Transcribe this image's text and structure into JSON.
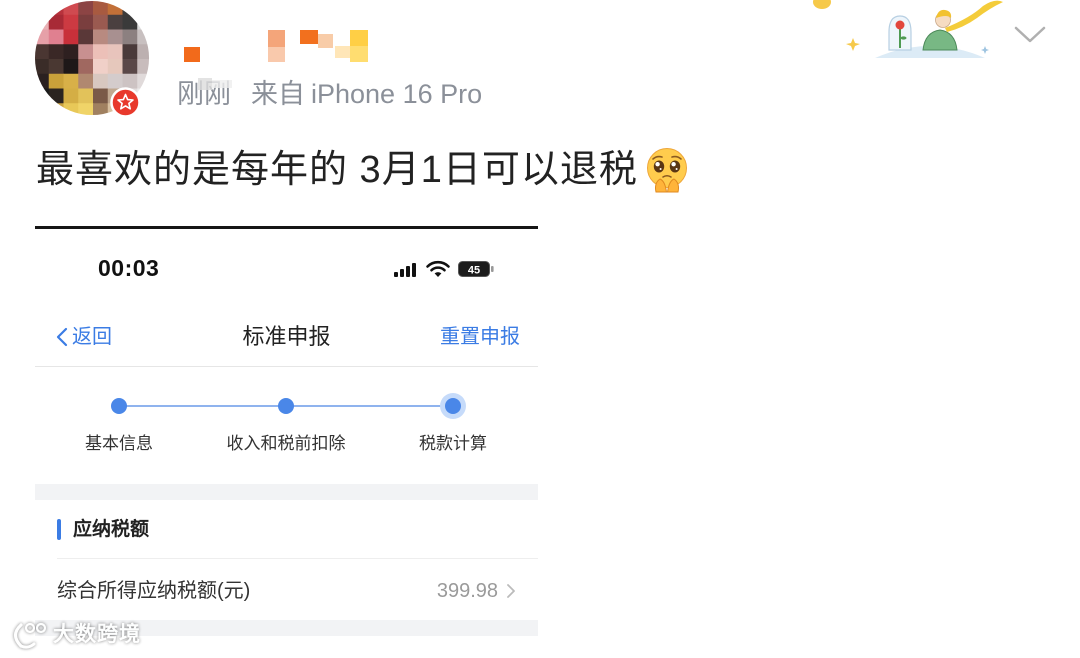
{
  "post": {
    "time": "刚刚",
    "source_prefix": "来自",
    "source_device": "iPhone 16 Pro",
    "text": "最喜欢的是每年的 3月1日可以退税",
    "emoji_icon": "pleading-face-emoji"
  },
  "icons": {
    "avatar_badge": "star-badge-icon",
    "menu": "chevron-down-icon",
    "decoration": "little-prince-illustration",
    "watermark_logo": "watermark-logo-icon"
  },
  "colors": {
    "text_primary": "#222222",
    "text_meta": "#8b9099",
    "accent_blue": "#3b7ce4",
    "badge_red": "#e8392c",
    "section_gray": "#f2f3f5"
  },
  "screenshot": {
    "status_bar": {
      "time": "00:03",
      "battery": "45"
    },
    "nav": {
      "back_label": "返回",
      "title": "标准申报",
      "action_label": "重置申报"
    },
    "steps": [
      {
        "label": "基本信息",
        "active": false
      },
      {
        "label": "收入和税前扣除",
        "active": false
      },
      {
        "label": "税款计算",
        "active": true
      }
    ],
    "section": {
      "title": "应纳税额",
      "rows": [
        {
          "label": "综合所得应纳税额(元)",
          "value": "399.98"
        }
      ]
    }
  },
  "watermark": {
    "text": "大数跨境"
  }
}
